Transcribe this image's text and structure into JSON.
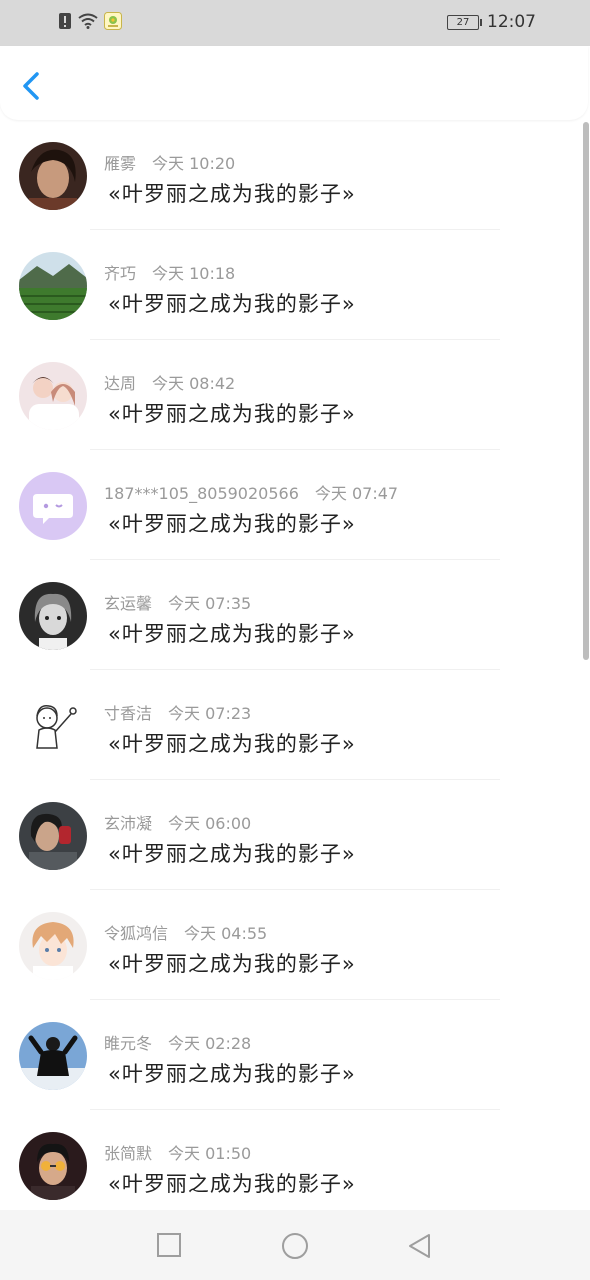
{
  "status_bar": {
    "time": "12:07",
    "battery": "27",
    "icons": [
      "alert-icon",
      "wifi-icon",
      "app-notification-icon"
    ]
  },
  "header": {
    "back_icon": "chevron-left-icon",
    "accent": "#2196F3"
  },
  "messages": [
    {
      "name": "雁雾",
      "time": "今天 10:20",
      "text": "«叶罗丽之成为我的影子»",
      "avatar": "portrait-avatar"
    },
    {
      "name": "齐巧",
      "time": "今天 10:18",
      "text": "«叶罗丽之成为我的影子»",
      "avatar": "landscape-avatar"
    },
    {
      "name": "达周",
      "time": "今天 08:42",
      "text": "«叶罗丽之成为我的影子»",
      "avatar": "couple-avatar"
    },
    {
      "name": "187***105_8059020566",
      "time": "今天 07:47",
      "text": "«叶罗丽之成为我的影子»",
      "avatar": "default-chat-avatar"
    },
    {
      "name": "玄运馨",
      "time": "今天 07:35",
      "text": "«叶罗丽之成为我的影子»",
      "avatar": "girl-bw-avatar"
    },
    {
      "name": "寸香洁",
      "time": "今天 07:23",
      "text": "«叶罗丽之成为我的影子»",
      "avatar": "sketch-avatar"
    },
    {
      "name": "玄沛凝",
      "time": "今天 06:00",
      "text": "«叶罗丽之成为我的影子»",
      "avatar": "drink-avatar"
    },
    {
      "name": "令狐鸿信",
      "time": "今天 04:55",
      "text": "«叶罗丽之成为我的影子»",
      "avatar": "anime-avatar"
    },
    {
      "name": "睢元冬",
      "time": "今天 02:28",
      "text": "«叶罗丽之成为我的影子»",
      "avatar": "sky-figure-avatar"
    },
    {
      "name": "张简默",
      "time": "今天 01:50",
      "text": "«叶罗丽之成为我的影子»",
      "avatar": "sunglasses-avatar"
    }
  ],
  "nav_keys": [
    "recent-apps-icon",
    "home-icon",
    "back-triangle-icon"
  ]
}
